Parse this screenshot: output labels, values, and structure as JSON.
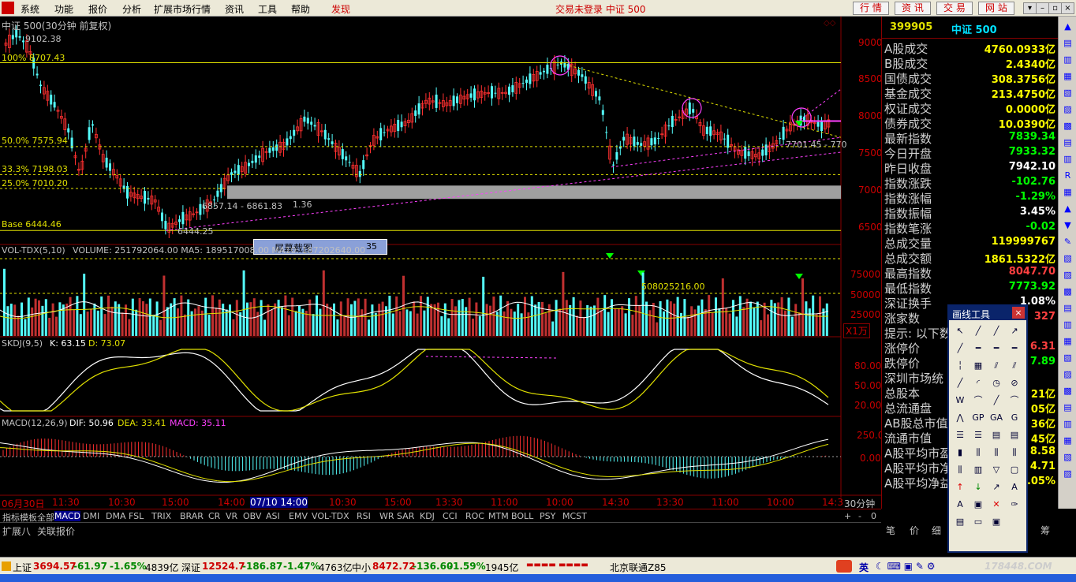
{
  "menu": {
    "items": [
      "系统",
      "功能",
      "报价",
      "分析",
      "扩展市场行情",
      "资讯",
      "工具",
      "帮助"
    ],
    "highlight": "发现",
    "status_text": "交易未登录  中证 500",
    "right_buttons": [
      "行 情",
      "资 讯",
      "交 易",
      "网 站"
    ],
    "window_buttons": [
      "▾",
      "–",
      "▫",
      "×"
    ]
  },
  "chart": {
    "title": "中证 500(30分钟 前复权)",
    "high_label": "9102.38",
    "fib_levels": [
      {
        "label": "100% 8707.43",
        "value": 8707.43
      },
      {
        "label": "50.0% 7575.94",
        "value": 7575.94
      },
      {
        "label": "33.3% 7198.03",
        "value": 7198.03
      },
      {
        "label": "25.0% 7010.20",
        "value": 7010.2
      },
      {
        "label": "Base 6444.46",
        "value": 6444.46
      }
    ],
    "low_label": "6444.25",
    "range_label": "6857.14 - 6861.83",
    "range_suffix": "1.36",
    "right_label": "7701.45 - 770",
    "screenshot_btn": "屏幕截图",
    "screenshot_num": "35",
    "price_axis": [
      "9000",
      "8500",
      "8000",
      "7500",
      "7000",
      "6500"
    ],
    "volume_header": "VOLUME: 251792064.00  MA5: 189517008.00  MA10: 187202640.00",
    "volume_title": "VOL-TDX(5,10)",
    "volume_axis": [
      "75000",
      "50000",
      "25000"
    ],
    "volume_unit": "X1万",
    "volume_marker": "508025216.00",
    "skdj_title": "SKDJ(9,5)",
    "skdj_k": "K: 63.15",
    "skdj_d": "D: 73.07",
    "skdj_axis": [
      "80.00",
      "50.00",
      "20.00"
    ],
    "macd_title": "MACD(12,26,9)",
    "macd_dif": "DIF: 50.96",
    "macd_dea": "DEA: 33.41",
    "macd_macd": "MACD: 35.11",
    "macd_axis": [
      "250.0",
      "0.00"
    ],
    "time_axis": [
      "06月30日",
      "11:30",
      "10:30",
      "15:00",
      "14:00",
      "07/10 14:00",
      "10:30",
      "15:00",
      "13:30",
      "11:00",
      "10:00",
      "14:30",
      "13:30",
      "11:00",
      "10:00",
      "14:3"
    ],
    "period_label": "30分钟"
  },
  "panel": {
    "code": "399905",
    "name": "中证 500",
    "rows": [
      {
        "label": "A股成交",
        "value": "4760.0933亿",
        "color": "#ffff00"
      },
      {
        "label": "B股成交",
        "value": "2.4340亿",
        "color": "#ffff00"
      },
      {
        "label": "国债成交",
        "value": "308.3756亿",
        "color": "#ffff00"
      },
      {
        "label": "基金成交",
        "value": "213.4750亿",
        "color": "#ffff00"
      },
      {
        "label": "权证成交",
        "value": "0.0000亿",
        "color": "#ffff00"
      },
      {
        "label": "债券成交",
        "value": "10.0390亿",
        "color": "#ffff00"
      },
      {
        "label": "最新指数",
        "value": "7839.34",
        "color": "#00ff00"
      },
      {
        "label": "今日开盘",
        "value": "7933.32",
        "color": "#00ff00"
      },
      {
        "label": "昨日收盘",
        "value": "7942.10",
        "color": "#ffffff"
      },
      {
        "label": "指数涨跌",
        "value": "-102.76",
        "color": "#00ff00"
      },
      {
        "label": "指数涨幅",
        "value": "-1.29%",
        "color": "#00ff00"
      },
      {
        "label": "指数振幅",
        "value": "3.45%",
        "color": "#ffffff"
      },
      {
        "label": "指数笔涨",
        "value": "-0.02",
        "color": "#00ff00"
      },
      {
        "label": "总成交量",
        "value": "119999767",
        "color": "#ffff00"
      },
      {
        "label": "总成交额",
        "value": "1861.5322亿",
        "color": "#ffff00"
      },
      {
        "label": "最高指数",
        "value": "8047.70",
        "color": "#ff4040"
      },
      {
        "label": "最低指数",
        "value": "7773.92",
        "color": "#00ff00"
      },
      {
        "label": "深证换手",
        "value": "1.08%",
        "color": "#ffffff"
      },
      {
        "label": "涨家数",
        "value": "327",
        "color": "#ff4040"
      },
      {
        "label": "提示: 以下数",
        "value": "",
        "color": "#c0c0c0"
      },
      {
        "label": "涨停价",
        "value": "6.31",
        "color": "#ff4040"
      },
      {
        "label": "跌停价",
        "value": "7.89",
        "color": "#00ff00"
      },
      {
        "label": "深圳市场统",
        "value": "",
        "color": "#c0c0c0"
      },
      {
        "label": "总股本",
        "value": "21亿",
        "color": "#ffff00"
      },
      {
        "label": "总流通盘",
        "value": "05亿",
        "color": "#ffff00"
      },
      {
        "label": "AB股总市值",
        "value": "36亿",
        "color": "#ffff00"
      },
      {
        "label": "流通市值",
        "value": "45亿",
        "color": "#ffff00"
      },
      {
        "label": "A股平均市盈",
        "value": "8.58",
        "color": "#ffff00"
      },
      {
        "label": "A股平均市净",
        "value": "4.71",
        "color": "#ffff00"
      },
      {
        "label": "A股平均净益",
        "value": ".05%",
        "color": "#ffff00"
      }
    ],
    "tabs": [
      "笔",
      "价",
      "细",
      "筹"
    ]
  },
  "tabs": {
    "indicators": [
      "指标",
      "模板",
      "全部",
      "MACD",
      "DMI",
      "DMA",
      "FSL",
      "TRIX",
      "BRAR",
      "CR",
      "VR",
      "OBV",
      "ASI",
      "EMV",
      "VOL-TDX",
      "RSI",
      "WR",
      "SAR",
      "KDJ",
      "CCI",
      "ROC",
      "MTM",
      "BOLL",
      "PSY",
      "MCST"
    ],
    "active": "MACD",
    "bottom": [
      "扩展八",
      "关联报价"
    ],
    "zoom": [
      "+",
      "-",
      "0"
    ]
  },
  "drawing_tool": {
    "title": "画线工具",
    "close": "×"
  },
  "statusbar": {
    "sh_label": "上证",
    "sh_value": "3694.57",
    "sh_change": "-61.97",
    "sh_pct": "-1.65%",
    "sh_amt": "4839亿",
    "sz_label": "深证",
    "sz_value": "12524.7",
    "sz_change": "-186.87",
    "sz_pct": "-1.47%",
    "sz_amt": "4763亿",
    "zx_label": "中小",
    "zx_value": "8472.72",
    "zx_change": "-136.60",
    "zx_pct": "-1.59%",
    "zx_amt": "1945亿",
    "server": "北京联通Z85",
    "ime": "英",
    "watermark": "178448.COM"
  }
}
